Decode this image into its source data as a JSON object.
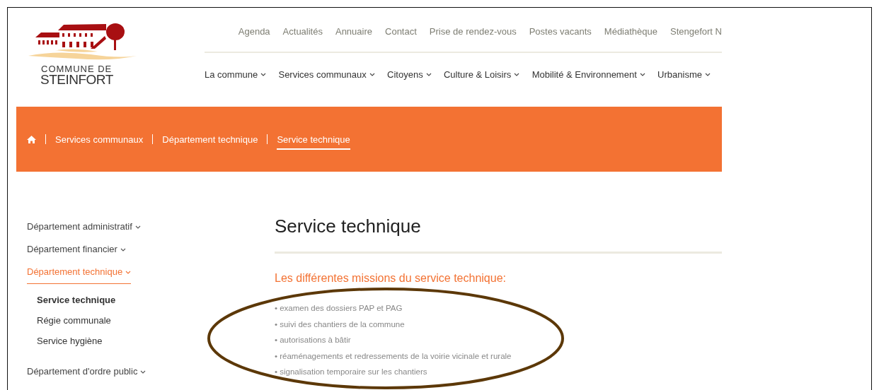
{
  "logo": {
    "line_1": "COMMUNE DE",
    "line_2": "STEINFORT"
  },
  "top_nav": [
    "Agenda",
    "Actualités",
    "Annuaire",
    "Contact",
    "Prise de rendez-vous",
    "Postes vacants",
    "Médiathèque",
    "Stengefort N"
  ],
  "main_nav": [
    "La commune",
    "Services communaux",
    "Citoyens",
    "Culture & Loisirs",
    "Mobilité & Environnement",
    "Urbanisme"
  ],
  "breadcrumb": [
    {
      "label": "Services communaux",
      "selected": false
    },
    {
      "label": "Département technique",
      "selected": false
    },
    {
      "label": "Service technique",
      "selected": true
    }
  ],
  "sidebar": {
    "items": [
      {
        "label": "Département administratif",
        "selected": false
      },
      {
        "label": "Département financier",
        "selected": false
      },
      {
        "label": "Département technique",
        "selected": true,
        "children": [
          {
            "label": "Service technique",
            "selected": true
          },
          {
            "label": "Régie communale",
            "selected": false
          },
          {
            "label": "Service hygiène",
            "selected": false
          }
        ]
      },
      {
        "label": "Département d'ordre public",
        "selected": false
      }
    ]
  },
  "content": {
    "title": "Service technique",
    "subtitle": "Les différentes missions du service technique:",
    "missions": [
      "• examen des dossiers PAP et PAG",
      "• suivi des chantiers de la commune",
      "• autorisations à bâtir",
      "• réaménagements et redressements de la voirie vicinale et rurale",
      "• signalisation temporaire sur les chantiers"
    ]
  }
}
